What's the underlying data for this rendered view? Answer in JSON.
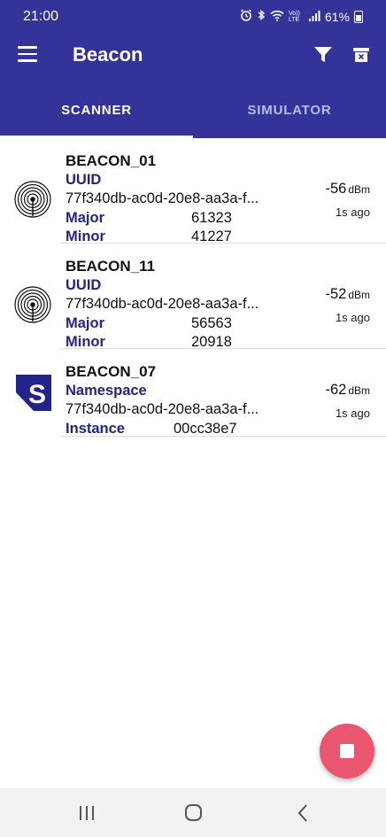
{
  "status_bar": {
    "time": "21:00",
    "network_label": "Vo)) LTE",
    "battery": "61%",
    "icons": [
      "alarm-icon",
      "bluetooth-icon",
      "wifi-icon",
      "signal-icon",
      "battery-icon"
    ]
  },
  "app_bar": {
    "title": "Beacon",
    "icons": [
      "menu-icon",
      "filter-icon",
      "delete-icon"
    ]
  },
  "tabs": [
    {
      "label": "SCANNER",
      "selected": true
    },
    {
      "label": "SIMULATOR",
      "selected": false
    }
  ],
  "beacons": [
    {
      "name": "BEACON_01",
      "type_icon": "ibeacon-icon",
      "id_label": "UUID",
      "id_value": "77f340db-ac0d-20e8-aa3a-f...",
      "major_label": "Major",
      "major_value": "61323",
      "minor_label": "Minor",
      "minor_value": "41227",
      "rssi": "-56",
      "rssi_unit": "dBm",
      "age": "1s ago"
    },
    {
      "name": "BEACON_11",
      "type_icon": "ibeacon-icon",
      "id_label": "UUID",
      "id_value": "77f340db-ac0d-20e8-aa3a-f...",
      "major_label": "Major",
      "major_value": "56563",
      "minor_label": "Minor",
      "minor_value": "20918",
      "rssi": "-52",
      "rssi_unit": "dBm",
      "age": "1s ago"
    },
    {
      "name": "BEACON_07",
      "type_icon": "eddystone-icon",
      "namespace_label": "Namespace",
      "namespace_value": "77f340db-ac0d-20e8-aa3a-f...",
      "instance_label": "Instance",
      "instance_value": "00cc38e7",
      "rssi": "-62",
      "rssi_unit": "dBm",
      "age": "1s ago"
    }
  ],
  "fab": {
    "icon": "stop-icon",
    "color": "#ea5570"
  },
  "nav_bar": {
    "icons": [
      "recents-icon",
      "home-icon",
      "back-icon"
    ]
  },
  "colors": {
    "primary": "#33339a",
    "label": "#23238a",
    "accent": "#ea5570"
  }
}
